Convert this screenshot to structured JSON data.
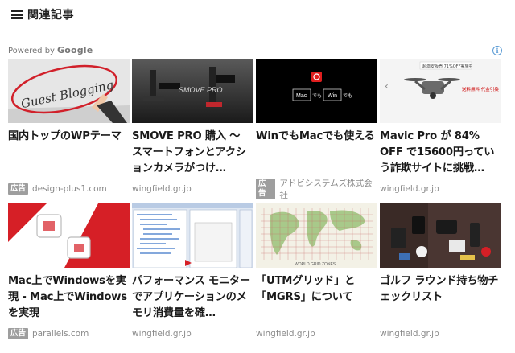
{
  "header": {
    "title": "関連記事",
    "icon": "list-icon"
  },
  "powered_by": {
    "text": "Powered by",
    "brand": "Google"
  },
  "ad_info_icon": "info-icon",
  "ad_badge_label": "広告",
  "cards": [
    {
      "title": "国内トップのWPテーマ",
      "source": "design-plus1.com",
      "is_ad": true,
      "thumb_text": "Guest Blogging"
    },
    {
      "title": "SMOVE PRO 購入 ～ スマートフォンとアクションカメラがつけ…",
      "source": "wingfield.gr.jp",
      "is_ad": false,
      "thumb_text": "SMOVE PRO"
    },
    {
      "title": "WinでもMacでも使える",
      "source": "アドビシステムズ株式会社",
      "is_ad": true,
      "thumb_mac": "Mac",
      "thumb_middle": "でも",
      "thumb_win": "Win",
      "thumb_end": "でも"
    },
    {
      "title": "Mavic Pro が 84% OFF で15600円っていう詐欺サイトに挑戦…",
      "source": "wingfield.gr.jp",
      "is_ad": false,
      "thumb_banner": "超激安販売 71%OFF実施中",
      "thumb_text": "送料無料 代金引換 タイムセール"
    },
    {
      "title": "Mac上でWindowsを実現 - Mac上でWindowsを実現",
      "source": "parallels.com",
      "is_ad": true
    },
    {
      "title": "パフォーマンス モニターでアプリケーションのメモリ消費量を確…",
      "source": "wingfield.gr.jp",
      "is_ad": false
    },
    {
      "title": "「UTMグリッド」と「MGRS」について",
      "source": "wingfield.gr.jp",
      "is_ad": false,
      "thumb_text": "WORLD GRID ZONES"
    },
    {
      "title": "ゴルフ ラウンド持ち物チェックリスト",
      "source": "wingfield.gr.jp",
      "is_ad": false
    }
  ]
}
